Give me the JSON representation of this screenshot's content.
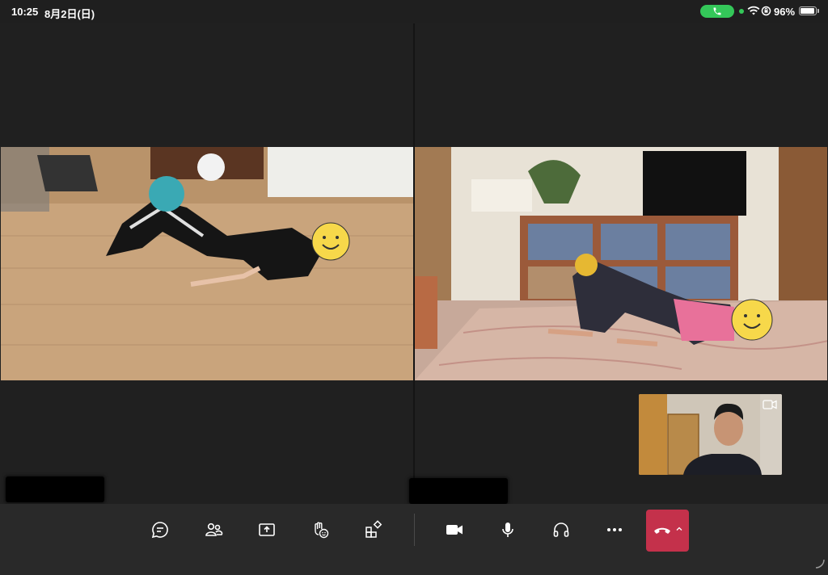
{
  "status_bar": {
    "time": "10:25",
    "date": "8月2日(日)",
    "battery": "96%",
    "call_indicator_color": "#34c759"
  },
  "participants": [
    {
      "position": "left",
      "name_tag": ""
    },
    {
      "position": "right",
      "name_tag": ""
    }
  ],
  "self_view": {
    "switch_icon": "camera-switch-icon"
  },
  "toolbar": {
    "buttons": [
      {
        "id": "chat",
        "icon": "chat-icon"
      },
      {
        "id": "people",
        "icon": "people-icon"
      },
      {
        "id": "share",
        "icon": "share-screen-icon"
      },
      {
        "id": "reactions",
        "icon": "raise-hand-react-icon"
      },
      {
        "id": "apps",
        "icon": "apps-icon"
      },
      {
        "id": "camera",
        "icon": "video-camera-icon"
      },
      {
        "id": "mic",
        "icon": "microphone-icon"
      },
      {
        "id": "audio",
        "icon": "headphones-icon"
      },
      {
        "id": "more",
        "icon": "more-icon"
      },
      {
        "id": "leave",
        "icon": "hang-up-icon"
      }
    ],
    "hangup_color": "#c4314b"
  }
}
